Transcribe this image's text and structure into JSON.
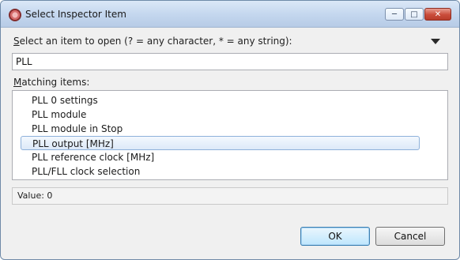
{
  "window": {
    "title": "Select Inspector Item",
    "controls": {
      "minimize_icon": "minimize-icon",
      "maximize_icon": "maximize-icon",
      "close_icon": "close-icon"
    }
  },
  "prompt": {
    "accel_char": "S",
    "text_rest": "elect an item to open (? = any character, * = any string):"
  },
  "search": {
    "value": "PLL"
  },
  "matching": {
    "accel_char": "M",
    "text_rest": "atching items:"
  },
  "items": [
    "PLL 0 settings",
    "PLL module",
    "PLL module in Stop",
    "PLL output [MHz]",
    "PLL reference clock [MHz]",
    "PLL/FLL clock selection"
  ],
  "selected_index": 3,
  "value_text": "Value: 0",
  "buttons": {
    "ok": "OK",
    "cancel": "Cancel"
  },
  "colors": {
    "selection_border": "#8eb1da",
    "selection_fill": "#dce9f8",
    "titlebar": "#c3d6ee",
    "close_button": "#c94c3a"
  }
}
